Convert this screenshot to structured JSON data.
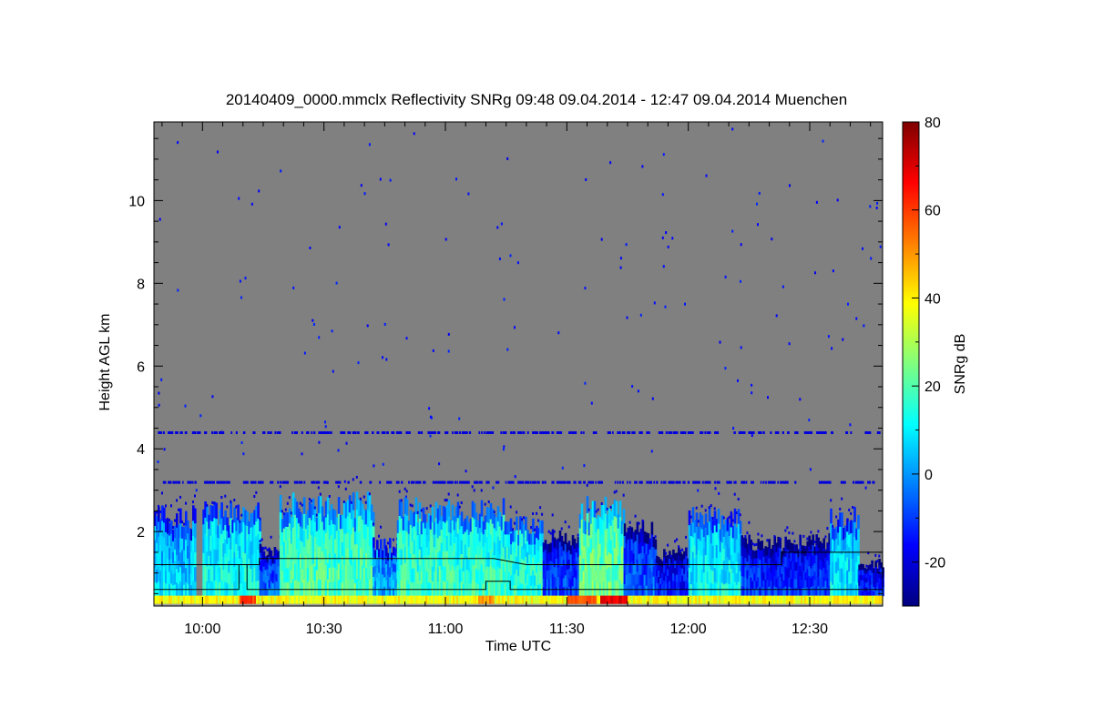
{
  "chart_data": {
    "type": "heatmap",
    "title": "20140409_0000.mmclx Reflectivity SNRg   09:48 09.04.2014 - 12:47 09.04.2014 Muenchen",
    "xlabel": "Time UTC",
    "ylabel": "Height AGL km",
    "colorbar_label": "SNRg dB",
    "x_range_min": [
      588,
      768
    ],
    "y_range_km": [
      0.2,
      11.9
    ],
    "x_ticks": [
      {
        "min": 600,
        "label": "10:00"
      },
      {
        "min": 630,
        "label": "10:30"
      },
      {
        "min": 660,
        "label": "11:00"
      },
      {
        "min": 690,
        "label": "11:30"
      },
      {
        "min": 720,
        "label": "12:00"
      },
      {
        "min": 750,
        "label": "12:30"
      }
    ],
    "y_ticks": [
      {
        "km": 2,
        "label": "2"
      },
      {
        "km": 4,
        "label": "4"
      },
      {
        "km": 6,
        "label": "6"
      },
      {
        "km": 8,
        "label": "8"
      },
      {
        "km": 10,
        "label": "10"
      }
    ],
    "colorbar_range": [
      -30,
      80
    ],
    "colorbar_ticks": [
      {
        "db": -20,
        "label": "-20"
      },
      {
        "db": 0,
        "label": "0"
      },
      {
        "db": 20,
        "label": "20"
      },
      {
        "db": 40,
        "label": "40"
      },
      {
        "db": 60,
        "label": "60"
      },
      {
        "db": 80,
        "label": "80"
      }
    ],
    "background_color": "#808080",
    "colormap": [
      "#00007f",
      "#0000ff",
      "#007fff",
      "#00ffff",
      "#7fff7f",
      "#ffff00",
      "#ff7f00",
      "#ff0000",
      "#7f0000"
    ],
    "cloud_columns": [
      {
        "t0": 588,
        "t1": 598,
        "top_km": 2.4,
        "mean_db": 8
      },
      {
        "t0": 600,
        "t1": 614,
        "top_km": 2.5,
        "mean_db": 14
      },
      {
        "t0": 614,
        "t1": 619,
        "top_km": 1.6,
        "mean_db": -5
      },
      {
        "t0": 619,
        "t1": 642,
        "top_km": 2.7,
        "mean_db": 20
      },
      {
        "t0": 642,
        "t1": 648,
        "top_km": 1.7,
        "mean_db": 2
      },
      {
        "t0": 648,
        "t1": 676,
        "top_km": 2.6,
        "mean_db": 18
      },
      {
        "t0": 676,
        "t1": 684,
        "top_km": 2.2,
        "mean_db": 16
      },
      {
        "t0": 684,
        "t1": 693,
        "top_km": 1.9,
        "mean_db": -8
      },
      {
        "t0": 693,
        "t1": 704,
        "top_km": 2.6,
        "mean_db": 24
      },
      {
        "t0": 704,
        "t1": 712,
        "top_km": 2.1,
        "mean_db": -6
      },
      {
        "t0": 712,
        "t1": 720,
        "top_km": 1.5,
        "mean_db": -12
      },
      {
        "t0": 720,
        "t1": 733,
        "top_km": 2.4,
        "mean_db": 12
      },
      {
        "t0": 733,
        "t1": 755,
        "top_km": 1.8,
        "mean_db": -10
      },
      {
        "t0": 755,
        "t1": 762,
        "top_km": 2.4,
        "mean_db": 10
      },
      {
        "t0": 762,
        "t1": 768,
        "top_km": 1.3,
        "mean_db": -12
      }
    ],
    "dashed_layers_km": [
      3.2,
      4.4
    ],
    "surface_hotspots": [
      {
        "t0": 609,
        "t1": 613,
        "db": 60
      },
      {
        "t0": 668,
        "t1": 672,
        "db": 50
      },
      {
        "t0": 690,
        "t1": 697,
        "db": 58
      },
      {
        "t0": 698,
        "t1": 705,
        "db": 68
      }
    ],
    "overlay_line_upper": [
      [
        588,
        1.2
      ],
      [
        614,
        1.2
      ],
      [
        614,
        1.35
      ],
      [
        672,
        1.35
      ],
      [
        680,
        1.2
      ],
      [
        743,
        1.2
      ],
      [
        743,
        1.5
      ],
      [
        768,
        1.5
      ]
    ],
    "overlay_line_lower": [
      [
        588,
        0.6
      ],
      [
        609,
        0.6
      ],
      [
        609,
        1.2
      ],
      [
        611,
        1.2
      ],
      [
        611,
        0.6
      ],
      [
        670,
        0.6
      ],
      [
        670,
        0.8
      ],
      [
        676,
        0.8
      ],
      [
        676,
        0.6
      ],
      [
        768,
        0.6
      ]
    ]
  }
}
